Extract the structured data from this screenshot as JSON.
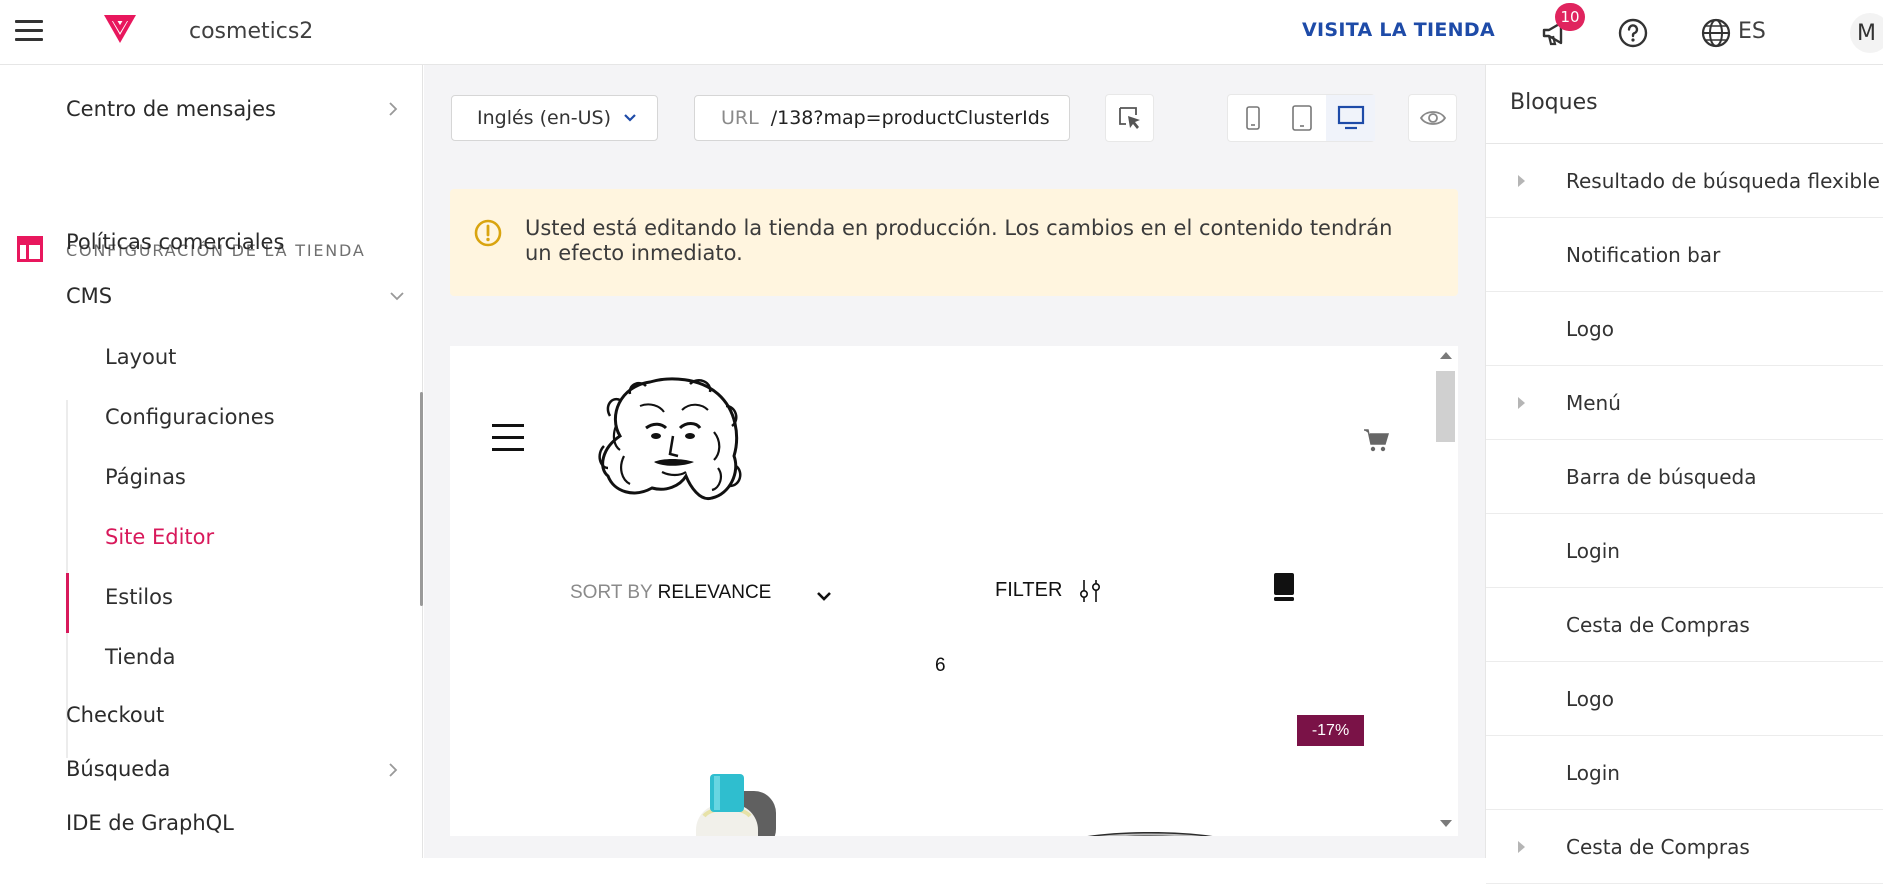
{
  "topbar": {
    "store_name": "cosmetics2",
    "visit_store": "VISITA LA TIENDA",
    "notifications_count": "10",
    "language": "ES",
    "avatar_initial": "M"
  },
  "sidebar": {
    "message_center": "Centro de mensajes",
    "section_title": "CONFIGURACIÓN DE LA TIENDA",
    "commercial_policies": "Políticas comerciales",
    "cms": "CMS",
    "cms_items": [
      "Layout",
      "Configuraciones",
      "Páginas",
      "Site Editor",
      "Estilos",
      "Tienda"
    ],
    "checkout": "Checkout",
    "search": "Búsqueda",
    "graphql_ide": "IDE de GraphQL"
  },
  "toolbar": {
    "locale_selected": "Inglés (en-US)",
    "url_label": "URL",
    "url_value": "/138?map=productClusterIds"
  },
  "alert": {
    "message": "Usted está editando la tienda en producción. Los cambios en el contenido tendrán un efecto inmediato."
  },
  "preview": {
    "sort_label": "SORT BY",
    "sort_value": "RELEVANCE",
    "filter_label": "FILTER",
    "product_count": "6",
    "discount_badge": "-17%"
  },
  "blocks_panel": {
    "title": "Bloques",
    "items": [
      {
        "label": "Resultado de búsqueda flexible",
        "expandable": true
      },
      {
        "label": "Notification bar",
        "expandable": false
      },
      {
        "label": "Logo",
        "expandable": false
      },
      {
        "label": "Menú",
        "expandable": true
      },
      {
        "label": "Barra de búsqueda",
        "expandable": false
      },
      {
        "label": "Login",
        "expandable": false
      },
      {
        "label": "Cesta de Compras",
        "expandable": false
      },
      {
        "label": "Logo",
        "expandable": false
      },
      {
        "label": "Login",
        "expandable": false
      },
      {
        "label": "Cesta de Compras",
        "expandable": true
      }
    ]
  },
  "colors": {
    "accent_pink": "#d8195b",
    "link_blue": "#1e4ba8",
    "alert_bg": "#fff5df",
    "discount_bg": "#7a1247"
  }
}
